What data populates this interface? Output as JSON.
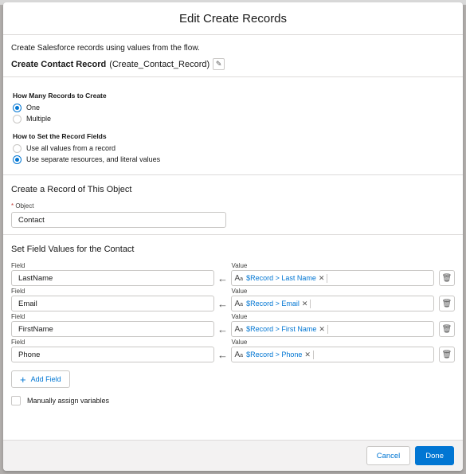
{
  "modal": {
    "title": "Edit Create Records"
  },
  "intro": {
    "description": "Create Salesforce records using values from the flow.",
    "element_label": "Create Contact Record",
    "element_api_name": "(Create_Contact_Record)"
  },
  "how_many": {
    "label": "How Many Records to Create",
    "options": [
      "One",
      "Multiple"
    ],
    "selected": "One"
  },
  "how_to_set": {
    "label": "How to Set the Record Fields",
    "options": [
      "Use all values from a record",
      "Use separate resources, and literal values"
    ],
    "selected": "Use separate resources, and literal values"
  },
  "object_section": {
    "heading": "Create a Record of This Object",
    "required_mark": "*",
    "field_label": "Object",
    "value": "Contact"
  },
  "field_values": {
    "heading": "Set Field Values for the Contact",
    "field_label": "Field",
    "value_label": "Value",
    "rows": [
      {
        "field": "LastName",
        "value": "$Record > Last Name"
      },
      {
        "field": "Email",
        "value": "$Record > Email"
      },
      {
        "field": "FirstName",
        "value": "$Record > First Name"
      },
      {
        "field": "Phone",
        "value": "$Record > Phone"
      }
    ],
    "add_field_label": "Add Field",
    "manual_assign_label": "Manually assign variables"
  },
  "footer": {
    "cancel_label": "Cancel",
    "done_label": "Done"
  },
  "icons": {
    "edit": "pencil-icon",
    "arrow": "left-arrow-icon",
    "text_type": "text-aa-icon",
    "remove": "close-icon",
    "delete": "trash-icon",
    "add": "plus-icon"
  },
  "colors": {
    "brand": "#0176d3",
    "border": "#c9c7c5",
    "required": "#c23934"
  }
}
